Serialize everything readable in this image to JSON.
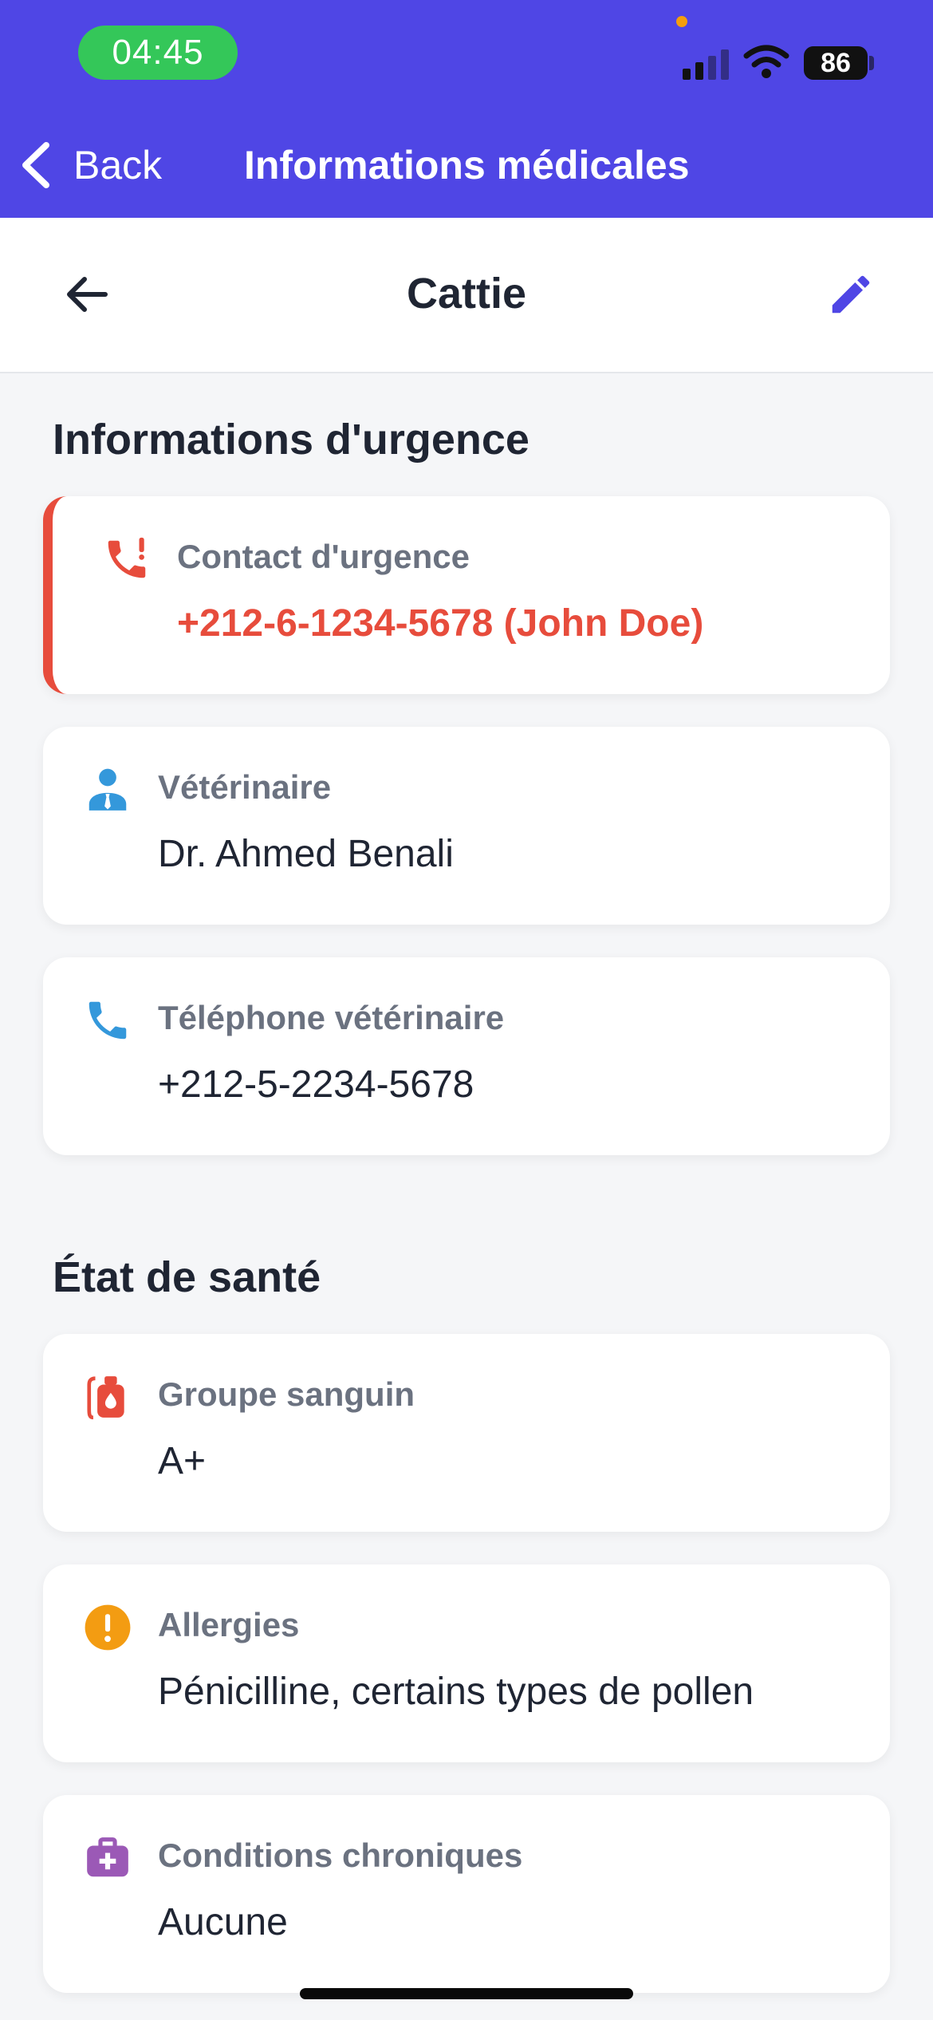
{
  "status_bar": {
    "time": "04:45",
    "battery": "86"
  },
  "nav": {
    "back_label": "Back",
    "title": "Informations médicales"
  },
  "header": {
    "title": "Cattie"
  },
  "sections": {
    "urgence": {
      "title": "Informations d'urgence"
    },
    "sante": {
      "title": "État de santé"
    }
  },
  "cards": {
    "emergency_contact": {
      "label": "Contact d'urgence",
      "value": "+212-6-1234-5678 (John Doe)",
      "icon": "emergency-phone-icon"
    },
    "veterinarian": {
      "label": "Vétérinaire",
      "value": "Dr. Ahmed Benali",
      "icon": "doctor-icon"
    },
    "vet_phone": {
      "label": "Téléphone vétérinaire",
      "value": "+212-5-2234-5678",
      "icon": "phone-icon"
    },
    "blood_group": {
      "label": "Groupe sanguin",
      "value": "A+",
      "icon": "blood-bag-icon"
    },
    "allergies": {
      "label": "Allergies",
      "value": "Pénicilline, certains types de pollen",
      "icon": "warning-icon"
    },
    "chronic": {
      "label": "Conditions chroniques",
      "value": "Aucune",
      "icon": "medical-bag-icon"
    }
  },
  "colors": {
    "primary": "#4f46e5",
    "emergency": "#e74c3c",
    "info": "#3498db",
    "warning": "#f39c12",
    "purple": "#9b59b6",
    "status_pill": "#34c759"
  }
}
